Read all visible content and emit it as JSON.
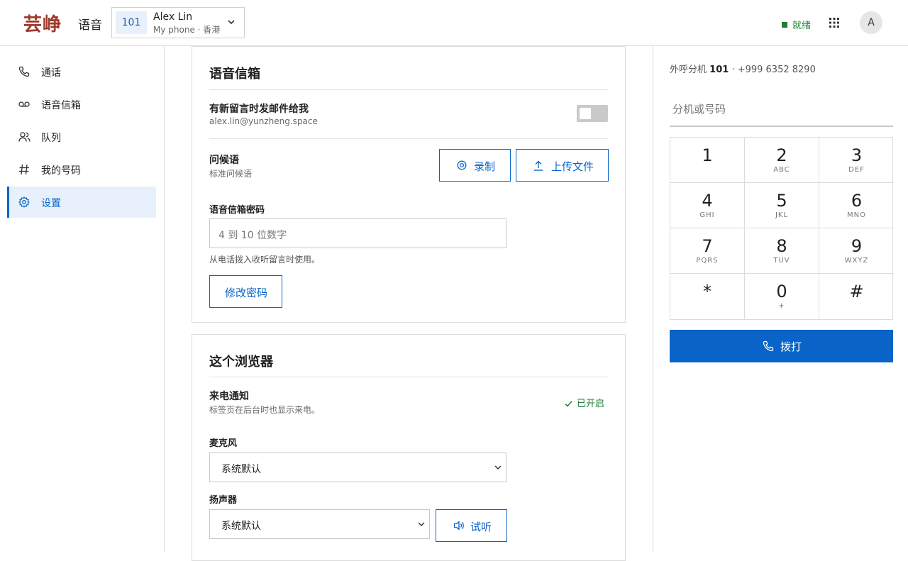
{
  "header": {
    "logo_text": "芸峥",
    "app_name": "语音",
    "phone": {
      "extension": "101",
      "name": "Alex Lin",
      "device": "My phone · 香港"
    },
    "status": "就绪",
    "avatar_initial": "A"
  },
  "sidebar": {
    "items": [
      {
        "label": "通话",
        "icon": "phone-icon"
      },
      {
        "label": "语音信箱",
        "icon": "voicemail-icon"
      },
      {
        "label": "队列",
        "icon": "users-icon"
      },
      {
        "label": "我的号码",
        "icon": "hash-icon"
      },
      {
        "label": "设置",
        "icon": "gear-icon",
        "active": true
      }
    ]
  },
  "voicemail": {
    "title": "语音信箱",
    "email_notify": {
      "label": "有新留言时发邮件给我",
      "email": "alex.lin@yunzheng.space",
      "enabled": false
    },
    "greeting": {
      "label": "问候语",
      "value": "标准问候语",
      "record_label": "录制",
      "upload_label": "上传文件"
    },
    "pin": {
      "label": "语音信箱密码",
      "placeholder": "4 到 10 位数字",
      "help": "从电话拨入收听留言时使用。",
      "change_label": "修改密码"
    }
  },
  "browser": {
    "title": "这个浏览器",
    "notify": {
      "label": "来电通知",
      "sub": "标签页在后台时也显示来电。",
      "status": "已开启"
    },
    "microphone": {
      "label": "麦克风",
      "value": "系统默认"
    },
    "speaker": {
      "label": "扬声器",
      "value": "系统默认",
      "test_label": "试听"
    }
  },
  "dialer": {
    "caller_prefix": "外呼分机",
    "caller_ext": "101",
    "caller_number": "· +999 6352 8290",
    "placeholder": "分机或号码",
    "keys": [
      {
        "d": "1",
        "l": ""
      },
      {
        "d": "2",
        "l": "ABC"
      },
      {
        "d": "3",
        "l": "DEF"
      },
      {
        "d": "4",
        "l": "GHI"
      },
      {
        "d": "5",
        "l": "JKL"
      },
      {
        "d": "6",
        "l": "MNO"
      },
      {
        "d": "7",
        "l": "PQRS"
      },
      {
        "d": "8",
        "l": "TUV"
      },
      {
        "d": "9",
        "l": "WXYZ"
      },
      {
        "d": "*",
        "l": ""
      },
      {
        "d": "0",
        "l": "+"
      },
      {
        "d": "#",
        "l": ""
      }
    ],
    "call_label": "拨打"
  },
  "colors": {
    "accent": "#0a64c8",
    "success": "#1e7e34",
    "logo": "#9e3a2c"
  }
}
